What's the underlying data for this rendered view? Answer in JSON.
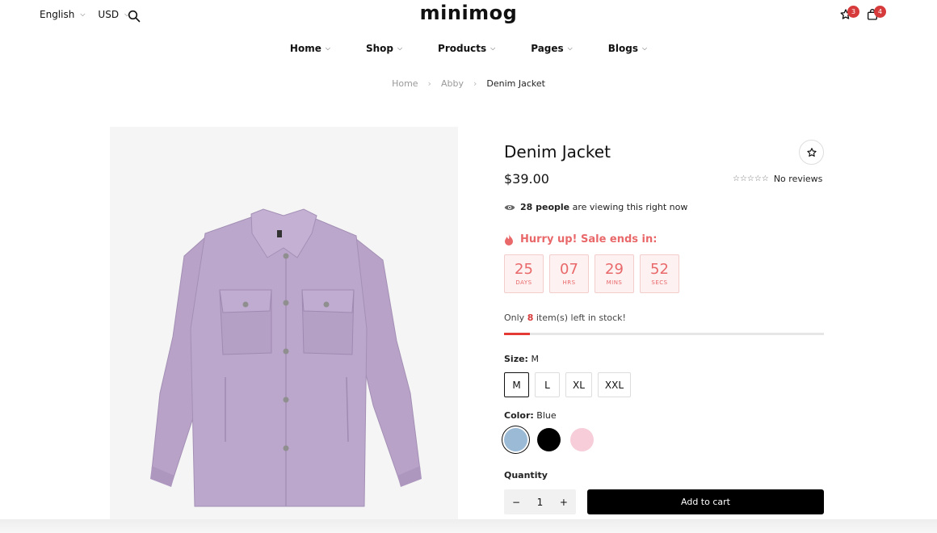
{
  "header": {
    "language": "English",
    "currency": "USD",
    "logo": "minimog",
    "wishlist_count": "3",
    "cart_count": "4"
  },
  "nav": {
    "items": [
      {
        "label": "Home"
      },
      {
        "label": "Shop"
      },
      {
        "label": "Products"
      },
      {
        "label": "Pages"
      },
      {
        "label": "Blogs"
      }
    ]
  },
  "breadcrumb": [
    "Home",
    "Abby",
    "Denim Jacket"
  ],
  "product": {
    "title": "Denim Jacket",
    "price": "$39.00",
    "reviews_text": "No reviews",
    "rating": 0,
    "viewers_count": "28 people",
    "viewers_text": "are viewing this right now",
    "hurry_text": "Hurry up! Sale ends in:",
    "countdown": [
      {
        "value": "25",
        "label": "DAYS"
      },
      {
        "value": "07",
        "label": "HRS"
      },
      {
        "value": "29",
        "label": "MINS"
      },
      {
        "value": "52",
        "label": "SECS"
      }
    ],
    "stock_prefix": "Only",
    "stock_count": "8",
    "stock_suffix": "item(s) left in stock!",
    "stock_fraction": 0.08,
    "size_label": "Size:",
    "size_selected": "M",
    "sizes": [
      "M",
      "L",
      "XL",
      "XXL"
    ],
    "color_label": "Color:",
    "color_selected": "Blue",
    "colors": [
      "#9bbad6",
      "#000000",
      "#f6cdd8"
    ],
    "quantity_label": "Quantity",
    "quantity": "1",
    "add_to_cart": "Add to cart"
  },
  "colors": {
    "accent_red": "#e9686a",
    "badge_red": "#d73a3a",
    "jacket": "#b9a3c9"
  }
}
